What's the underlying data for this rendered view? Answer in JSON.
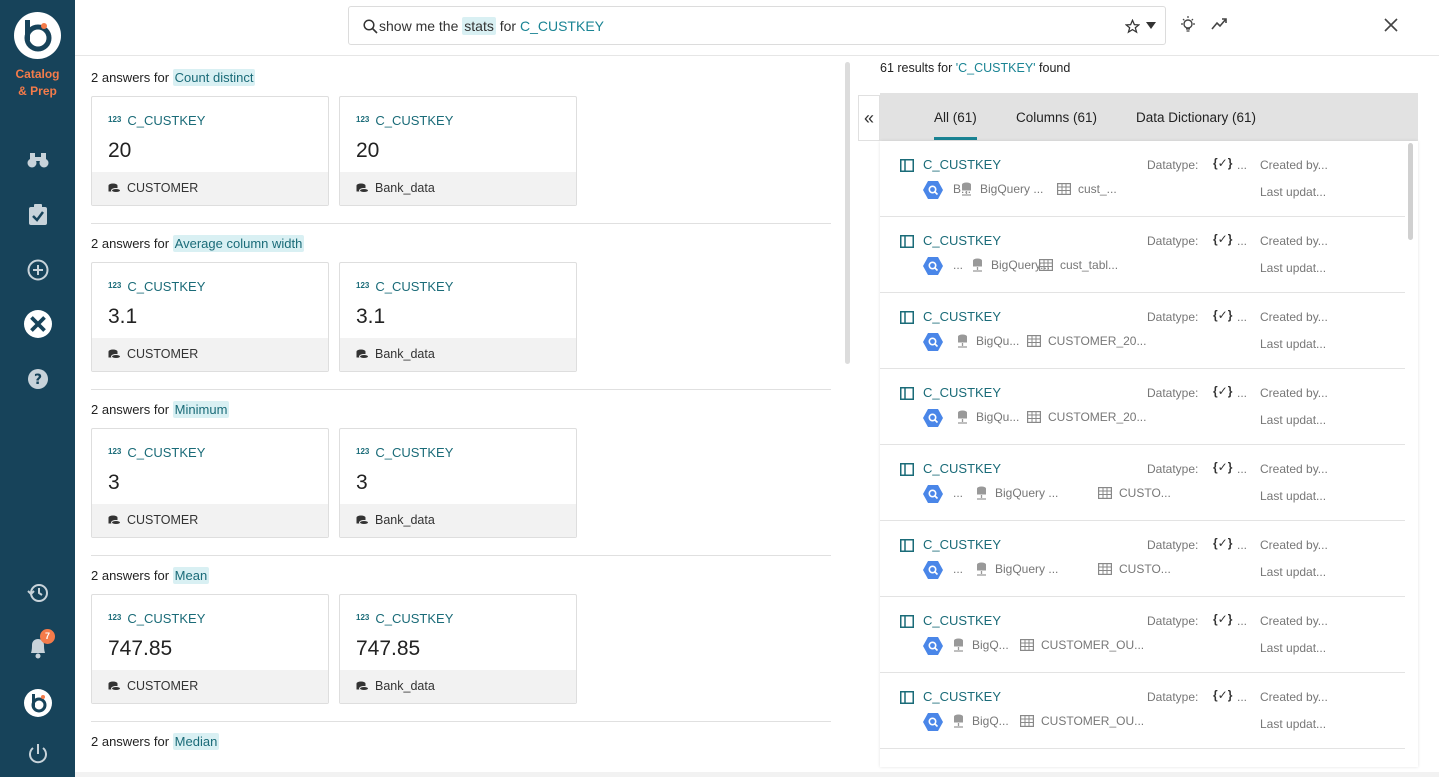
{
  "sidebar": {
    "brand_line1": "Catalog",
    "brand_line2": "& Prep",
    "notification_count": "7",
    "icons": [
      "binoculars-icon",
      "clipboard-check-icon",
      "plus-circle-icon",
      "tools-icon",
      "help-icon",
      "history-icon",
      "bell-icon",
      "logo-icon",
      "power-icon"
    ]
  },
  "search": {
    "prefix": "show me the",
    "keyword": "stats",
    "mid": "for",
    "term": "C_CUSTKEY"
  },
  "answers": [
    {
      "count_text": "2 answers for",
      "stat": "Count distinct",
      "cards": [
        {
          "column": "C_CUSTKEY",
          "value": "20",
          "table": "CUSTOMER"
        },
        {
          "column": "C_CUSTKEY",
          "value": "20",
          "table": "Bank_data"
        }
      ]
    },
    {
      "count_text": "2 answers for",
      "stat": "Average column width",
      "cards": [
        {
          "column": "C_CUSTKEY",
          "value": "3.1",
          "table": "CUSTOMER"
        },
        {
          "column": "C_CUSTKEY",
          "value": "3.1",
          "table": "Bank_data"
        }
      ]
    },
    {
      "count_text": "2 answers for",
      "stat": "Minimum",
      "cards": [
        {
          "column": "C_CUSTKEY",
          "value": "3",
          "table": "CUSTOMER"
        },
        {
          "column": "C_CUSTKEY",
          "value": "3",
          "table": "Bank_data"
        }
      ]
    },
    {
      "count_text": "2 answers for",
      "stat": "Mean",
      "cards": [
        {
          "column": "C_CUSTKEY",
          "value": "747.85",
          "table": "CUSTOMER"
        },
        {
          "column": "C_CUSTKEY",
          "value": "747.85",
          "table": "Bank_data"
        }
      ]
    },
    {
      "count_text": "2 answers for",
      "stat": "Median",
      "cards": []
    }
  ],
  "numeric_badge": "123",
  "results_header": {
    "prefix": "61 results for",
    "term": "'C_CUSTKEY'",
    "suffix": "found"
  },
  "tabs": [
    {
      "label": "All (61)"
    },
    {
      "label": "Columns (61)"
    },
    {
      "label": "Data Dictionary (61)"
    }
  ],
  "results": [
    {
      "title": "C_CUSTKEY",
      "m1": "B...",
      "m2": "BigQuery ...",
      "m3": "cust_...",
      "datatype": "Datatype:",
      "dtsym": "{✓}",
      "dots": "...",
      "created": "Created by...",
      "updated": "Last updat..."
    },
    {
      "title": "C_CUSTKEY",
      "m1": "...",
      "m2": "BigQuery...",
      "m3": "cust_tabl...",
      "datatype": "Datatype:",
      "dtsym": "{✓}",
      "dots": "...",
      "created": "Created by...",
      "updated": "Last updat..."
    },
    {
      "title": "C_CUSTKEY",
      "m1": "",
      "m2": "BigQu...",
      "m3": "CUSTOMER_20...",
      "datatype": "Datatype:",
      "dtsym": "{✓}",
      "dots": "...",
      "created": "Created by...",
      "updated": "Last updat..."
    },
    {
      "title": "C_CUSTKEY",
      "m1": "",
      "m2": "BigQu...",
      "m3": "CUSTOMER_20...",
      "datatype": "Datatype:",
      "dtsym": "{✓}",
      "dots": "...",
      "created": "Created by...",
      "updated": "Last updat..."
    },
    {
      "title": "C_CUSTKEY",
      "m1": "...",
      "m2": "BigQuery ...",
      "m3": "CUSTO...",
      "datatype": "Datatype:",
      "dtsym": "{✓}",
      "dots": "...",
      "created": "Created by...",
      "updated": "Last updat..."
    },
    {
      "title": "C_CUSTKEY",
      "m1": "...",
      "m2": "BigQuery ...",
      "m3": "CUSTO...",
      "datatype": "Datatype:",
      "dtsym": "{✓}",
      "dots": "...",
      "created": "Created by...",
      "updated": "Last updat..."
    },
    {
      "title": "C_CUSTKEY",
      "m1": "",
      "m2": "BigQ...",
      "m3": "CUSTOMER_OU...",
      "datatype": "Datatype:",
      "dtsym": "{✓}",
      "dots": "...",
      "created": "Created by...",
      "updated": "Last updat..."
    },
    {
      "title": "C_CUSTKEY",
      "m1": "",
      "m2": "BigQ...",
      "m3": "CUSTOMER_OU...",
      "datatype": "Datatype:",
      "dtsym": "{✓}",
      "dots": "...",
      "created": "Created by...",
      "updated": "Last updat..."
    }
  ],
  "colors": {
    "sidebar": "#17435a",
    "accent": "#1a8494",
    "brand": "#f47b4a",
    "highlight": "#d9f0f3"
  }
}
